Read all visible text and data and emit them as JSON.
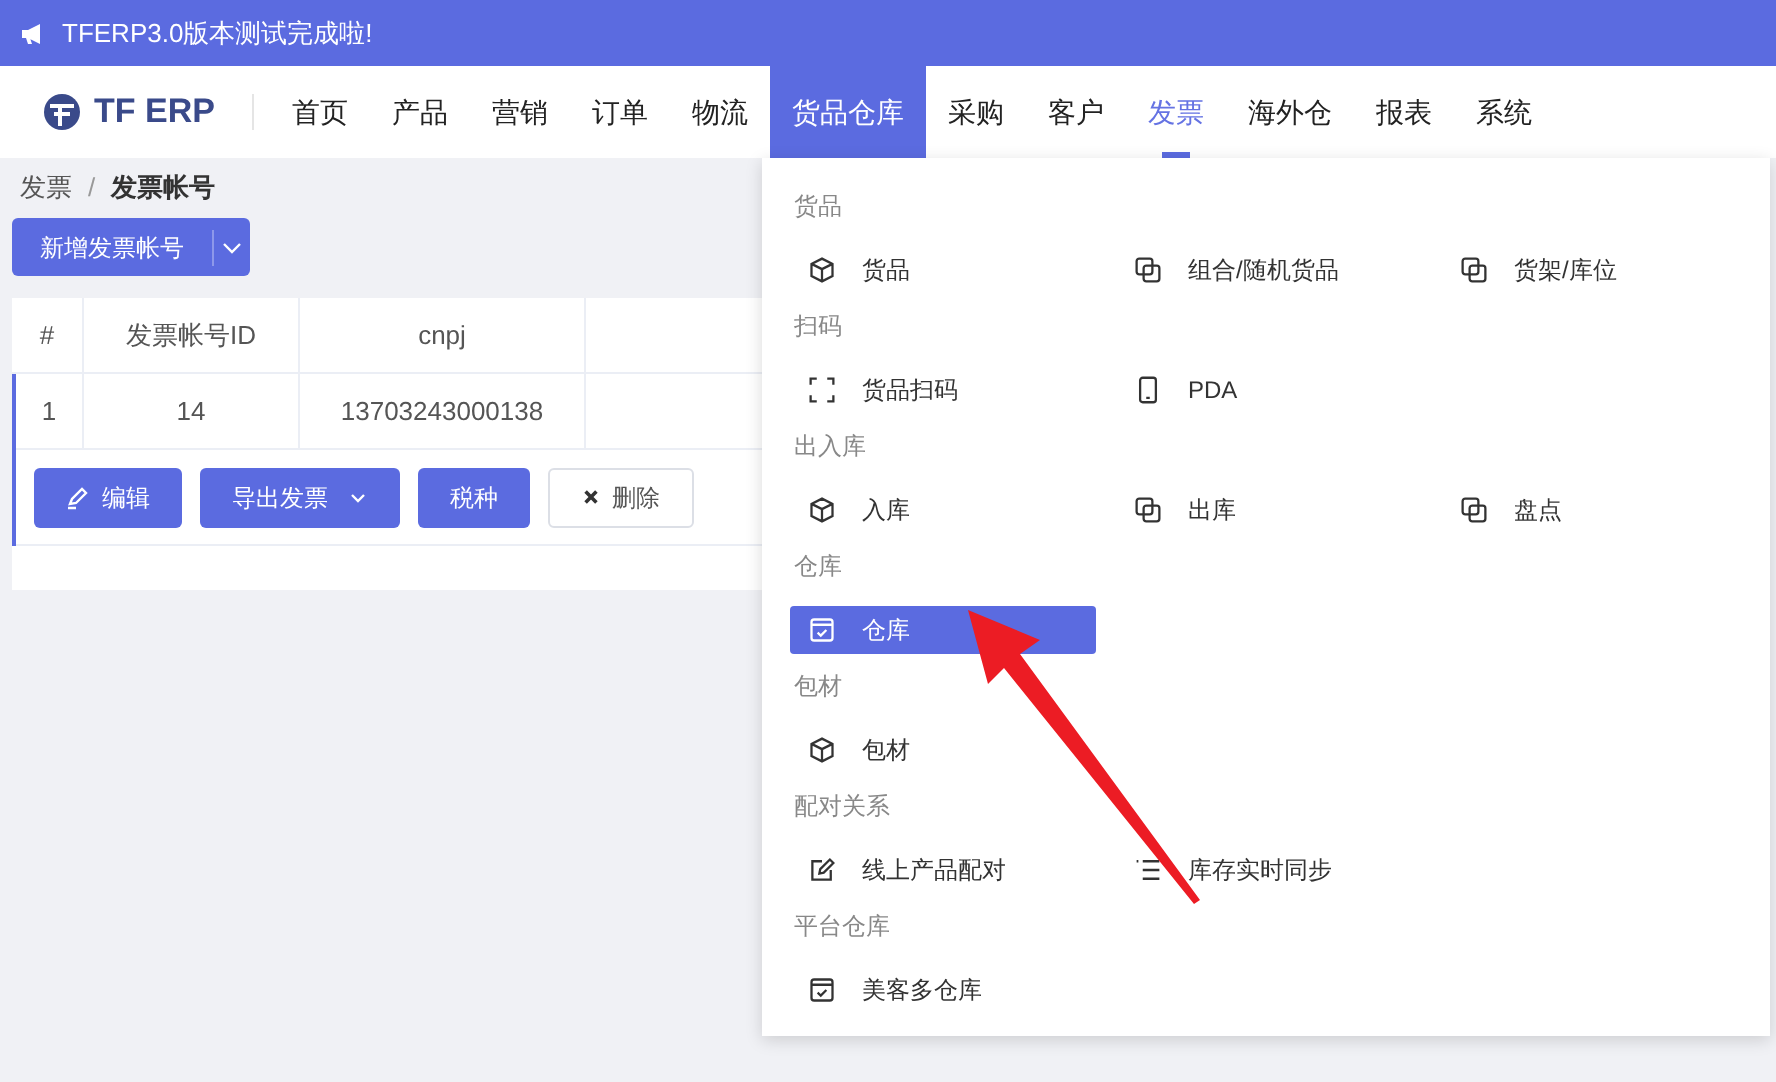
{
  "banner": {
    "text": "TFERP3.0版本测试完成啦!"
  },
  "logo": {
    "text": "TF ERP"
  },
  "nav": [
    {
      "label": "首页",
      "open": false,
      "selected": false
    },
    {
      "label": "产品",
      "open": false,
      "selected": false
    },
    {
      "label": "营销",
      "open": false,
      "selected": false
    },
    {
      "label": "订单",
      "open": false,
      "selected": false
    },
    {
      "label": "物流",
      "open": false,
      "selected": false
    },
    {
      "label": "货品仓库",
      "open": true,
      "selected": false
    },
    {
      "label": "采购",
      "open": false,
      "selected": false
    },
    {
      "label": "客户",
      "open": false,
      "selected": false
    },
    {
      "label": "发票",
      "open": false,
      "selected": true
    },
    {
      "label": "海外仓",
      "open": false,
      "selected": false
    },
    {
      "label": "报表",
      "open": false,
      "selected": false
    },
    {
      "label": "系统",
      "open": false,
      "selected": false
    }
  ],
  "breadcrumb": {
    "separator": "/",
    "items": [
      "发票",
      "发票帐号"
    ]
  },
  "add_button": {
    "label": "新增发票帐号"
  },
  "table": {
    "columns": [
      "#",
      "发票帐号ID",
      "cnpj"
    ],
    "rows": [
      {
        "cells": [
          "1",
          "14",
          "13703243000138"
        ]
      }
    ]
  },
  "row_actions": [
    {
      "label": "编辑",
      "kind": "edit"
    },
    {
      "label": "导出发票",
      "kind": "dropdown"
    },
    {
      "label": "税种",
      "kind": "plain"
    },
    {
      "label": "删除",
      "kind": "delete"
    }
  ],
  "menu": {
    "sections": [
      {
        "title": "货品",
        "items": [
          {
            "label": "货品",
            "kind": "cube",
            "selected": false
          },
          {
            "label": "组合/随机货品",
            "kind": "copy",
            "selected": false
          },
          {
            "label": "货架/库位",
            "kind": "copy",
            "selected": false
          }
        ]
      },
      {
        "title": "扫码",
        "items": [
          {
            "label": "货品扫码",
            "kind": "scan",
            "selected": false
          },
          {
            "label": "PDA",
            "kind": "phone",
            "selected": false
          }
        ]
      },
      {
        "title": "出入库",
        "items": [
          {
            "label": "入库",
            "kind": "cube",
            "selected": false
          },
          {
            "label": "出库",
            "kind": "copy",
            "selected": false
          },
          {
            "label": "盘点",
            "kind": "copy",
            "selected": false
          }
        ]
      },
      {
        "title": "仓库",
        "items": [
          {
            "label": "仓库",
            "kind": "check",
            "selected": true
          }
        ]
      },
      {
        "title": "包材",
        "items": [
          {
            "label": "包材",
            "kind": "cube",
            "selected": false
          }
        ]
      },
      {
        "title": "配对关系",
        "items": [
          {
            "label": "线上产品配对",
            "kind": "edit",
            "selected": false
          },
          {
            "label": "库存实时同步",
            "kind": "list",
            "selected": false
          }
        ]
      },
      {
        "title": "平台仓库",
        "items": [
          {
            "label": "美客多仓库",
            "kind": "check",
            "selected": false
          }
        ]
      }
    ]
  }
}
